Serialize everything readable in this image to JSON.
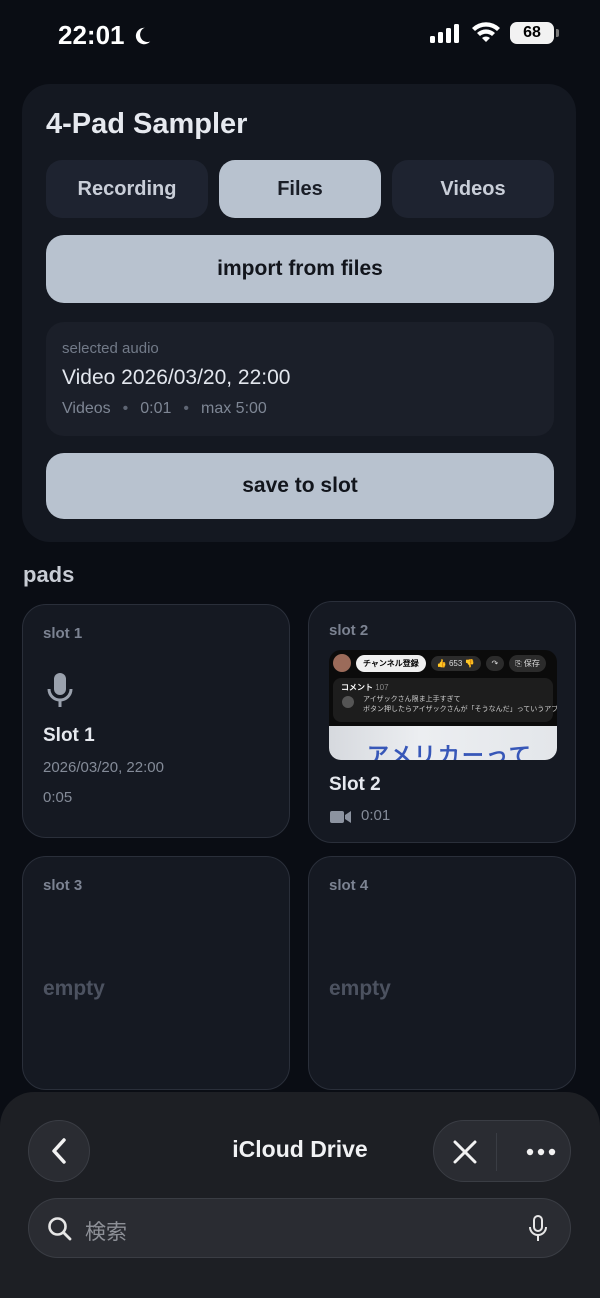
{
  "status_bar": {
    "time": "22:01",
    "battery": "68"
  },
  "app": {
    "title": "4-Pad Sampler",
    "tabs": [
      {
        "label": "Recording",
        "active": false
      },
      {
        "label": "Files",
        "active": true
      },
      {
        "label": "Videos",
        "active": false
      }
    ],
    "import_label": "import from files",
    "selected": {
      "label": "selected audio",
      "name": "Video 2026/03/20, 22:00",
      "source": "Videos",
      "duration": "0:01",
      "max": "max 5:00"
    },
    "save_label": "save to slot"
  },
  "pads": {
    "title": "pads",
    "slots": [
      {
        "slot": "slot 1",
        "name": "Slot 1",
        "date": "2026/03/20, 22:00",
        "duration": "0:05",
        "type": "audio"
      },
      {
        "slot": "slot 2",
        "name": "Slot 2",
        "duration": "0:01",
        "type": "video",
        "thumb": {
          "subscribe": "チャンネル登録",
          "likes": "653",
          "save": "保存",
          "comments_header": "コメント",
          "comments_count": "107",
          "line1": "アイザックさん限ま上手すぎて",
          "line2": "ボタン押したらアイザックさんが「そうなんだ」っていうアプリ欲…",
          "caption": "アメリカーって"
        }
      },
      {
        "slot": "slot 3",
        "empty": "empty"
      },
      {
        "slot": "slot 4",
        "empty": "empty"
      }
    ]
  },
  "sheet": {
    "title": "iCloud Drive",
    "search_placeholder": "検索"
  },
  "colors": {
    "background": "#0a0d14",
    "card": "#141821",
    "button_fill": "#b8c2cf",
    "sheet": "#1d1f24"
  }
}
